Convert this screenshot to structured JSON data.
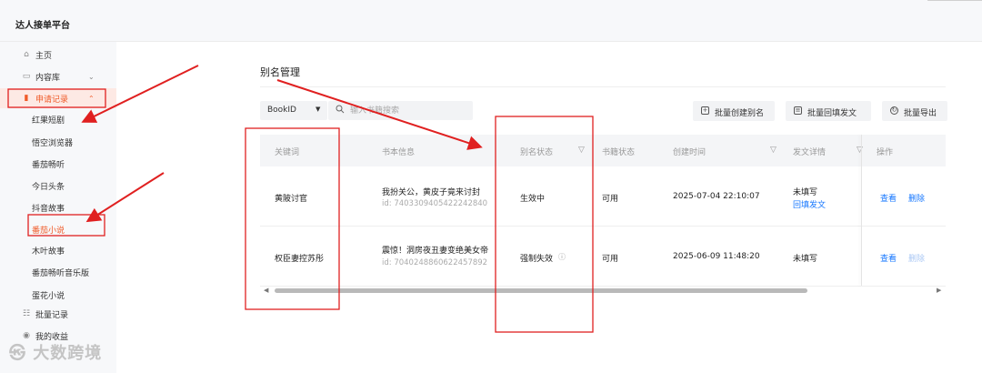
{
  "app": {
    "title": "达人接单平台"
  },
  "sidebar": {
    "items": [
      {
        "label": "主页",
        "icon": "home-icon"
      },
      {
        "label": "内容库",
        "icon": "content-library-icon"
      },
      {
        "label": "申请记录",
        "icon": "document-icon"
      },
      {
        "label": "批量记录",
        "icon": "list-icon"
      },
      {
        "label": "我的收益",
        "icon": "coin-icon"
      }
    ],
    "subitems": [
      "红果短剧",
      "悟空浏览器",
      "番茄畅听",
      "今日头条",
      "抖音故事",
      "番茄小说",
      "木叶故事",
      "番茄畅听音乐版",
      "蛋花小说"
    ]
  },
  "page": {
    "title": "别名管理"
  },
  "filters": {
    "select_value": "BookID",
    "search_placeholder": "输入书籍搜索"
  },
  "toolbar": {
    "batch_create": "批量创建别名",
    "batch_fill": "批量回填发文",
    "batch_export": "批量导出"
  },
  "table": {
    "headers": {
      "keyword": "关键词",
      "book_info": "书本信息",
      "alias_status": "别名状态",
      "book_status": "书籍状态",
      "created_at": "创建时间",
      "post_detail": "发文详情",
      "actions": "操作"
    },
    "rows": [
      {
        "keyword": "黄陂讨官",
        "book_title": "我扮关公，黄皮子竟来讨封",
        "book_id": "id: 7403309405422242840",
        "alias_status": "生效中",
        "book_status": "可用",
        "created_at": "2025-07-04 22:10:07",
        "post_detail": "未填写",
        "post_link": "回填发文",
        "view": "查看",
        "delete": "删除"
      },
      {
        "keyword": "权臣妻控苏彤",
        "book_title": "震惊！洞房夜丑妻变绝美女帝",
        "book_id": "id: 7040248860622457892",
        "alias_status": "强制失效",
        "book_status": "可用",
        "created_at": "2025-06-09 11:48:20",
        "post_detail": "未填写",
        "post_link": "",
        "view": "查看",
        "delete": "删除"
      }
    ]
  },
  "watermark": "大数跨境",
  "colors": {
    "accent": "#f05a28",
    "link": "#1677ff",
    "annotation": "#e02020"
  }
}
